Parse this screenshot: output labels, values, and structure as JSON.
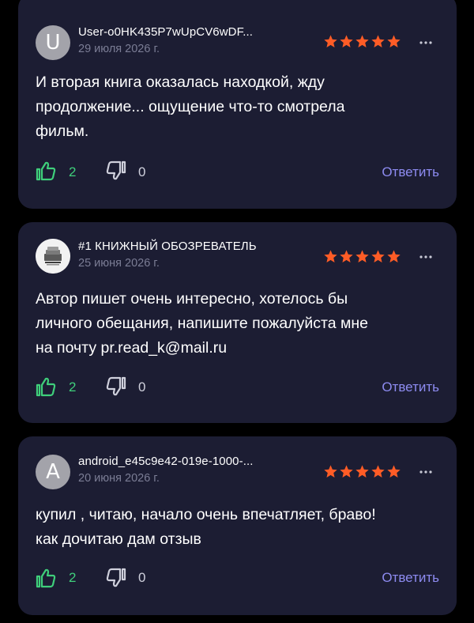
{
  "colors": {
    "background": "#000000",
    "card": "#1c1d33",
    "star": "#ff5c26",
    "like": "#3fcf7b",
    "reply": "#8d8bf0",
    "date": "#7b7d95"
  },
  "reviews": [
    {
      "avatar_letter": "U",
      "username": "User-o0HK435P7wUpCV6wDF...",
      "date": "29 июля 2026 г.",
      "rating": 5,
      "text_lines": [
        "И вторая книга оказалась находкой, жду",
        "продолжение... ощущение  что-то смотрела",
        "фильм."
      ],
      "likes": "2",
      "dislikes": "0",
      "reply_label": "Ответить",
      "more_icon": "ellipsis-icon"
    },
    {
      "avatar_letter": "",
      "avatar_icon": "books-logo-icon",
      "username": "#1 КНИЖНЫЙ ОБОЗРЕВАТЕЛЬ",
      "date": "25 июня 2026 г.",
      "rating": 5,
      "text_lines": [
        "Автор пишет очень интересно, хотелось бы",
        "личного обещания, напишите пожалуйста мне",
        "на почту pr.read_k@mail.ru"
      ],
      "likes": "2",
      "dislikes": "0",
      "reply_label": "Ответить",
      "more_icon": "ellipsis-icon"
    },
    {
      "avatar_letter": "A",
      "username": "android_e45c9e42-019e-1000-...",
      "date": "20 июня 2026 г.",
      "rating": 5,
      "text_lines": [
        "купил , читаю, начало очень впечатляет,  браво!",
        "как дочитаю дам отзыв"
      ],
      "likes": "2",
      "dislikes": "0",
      "reply_label": "Ответить",
      "more_icon": "ellipsis-icon"
    }
  ]
}
